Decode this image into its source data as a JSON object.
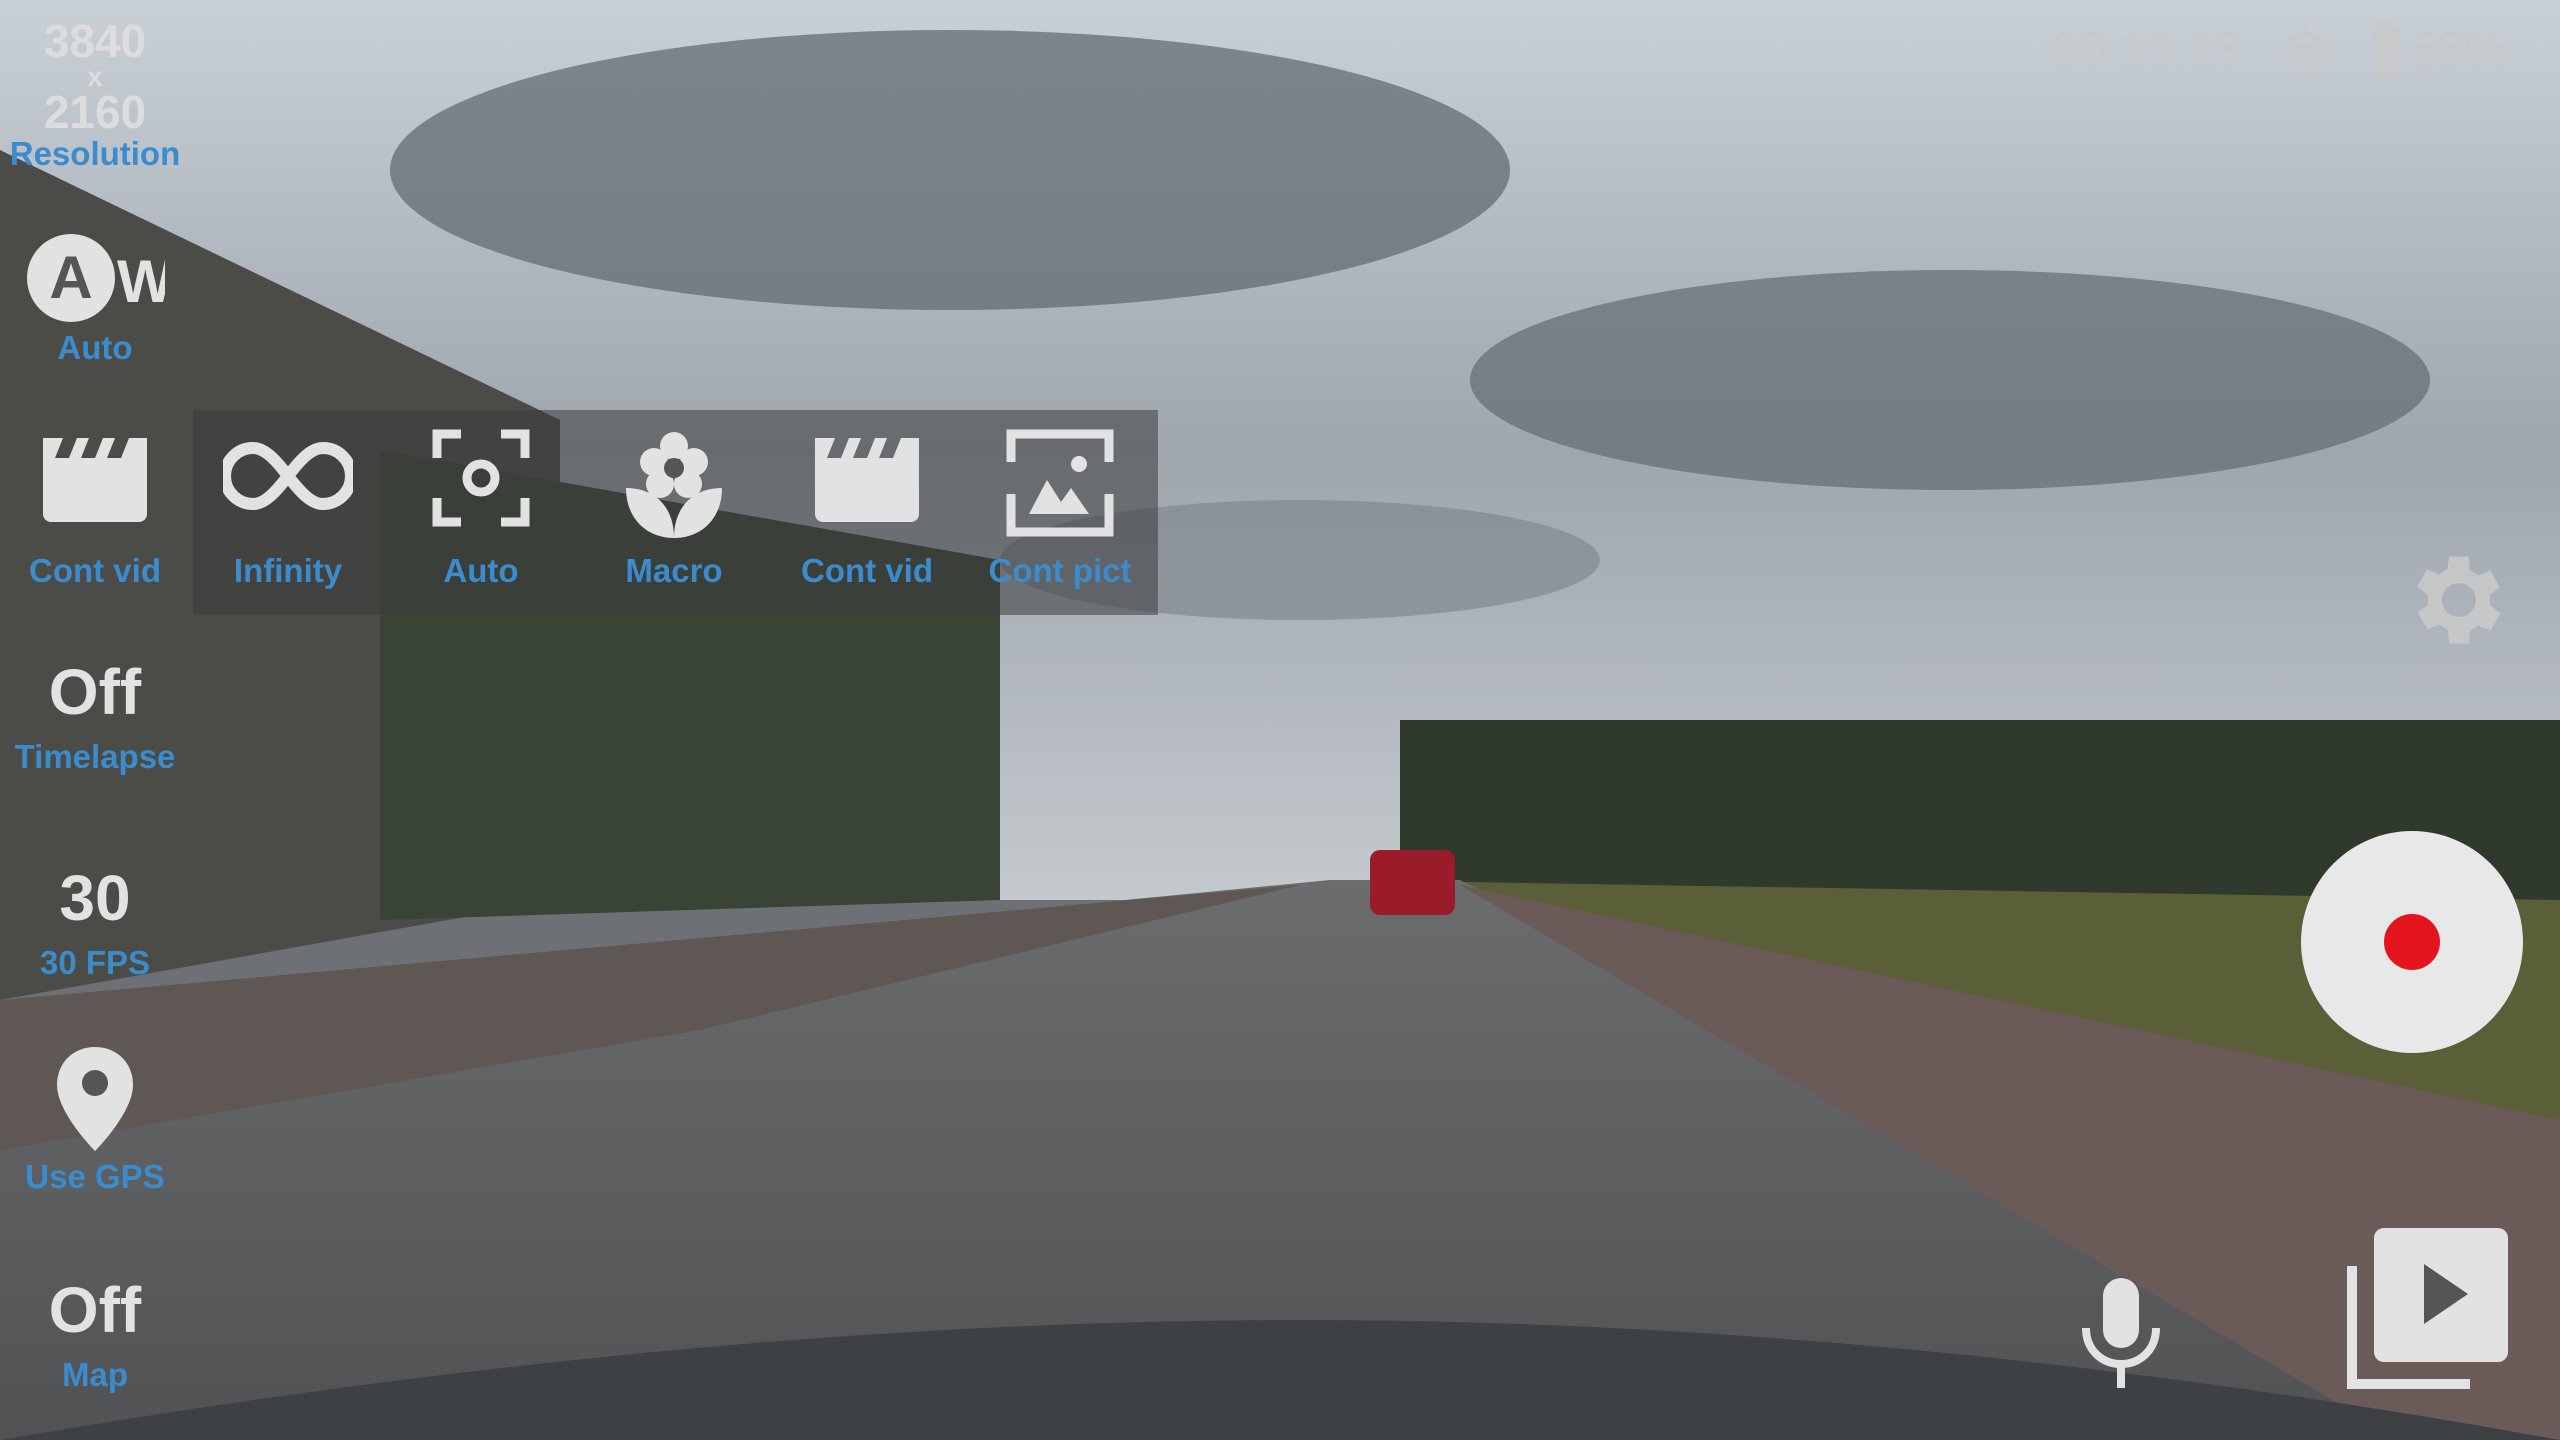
{
  "status": {
    "time": "00:13:23",
    "gps_icon": "gps-fixed-icon",
    "battery_icon": "battery-icon",
    "battery": "58%"
  },
  "left": {
    "resolution": {
      "width": "3840",
      "x": "x",
      "height": "2160",
      "label": "Resolution"
    },
    "white_balance": {
      "icon": "auto-white-balance-icon",
      "label": "Auto"
    },
    "mode": {
      "icon": "clapperboard-icon",
      "label": "Cont vid"
    },
    "timelapse": {
      "value": "Off",
      "label": "Timelapse"
    },
    "fps": {
      "value": "30",
      "label": "30 FPS"
    },
    "gps": {
      "icon": "location-pin-icon",
      "label": "Use GPS"
    },
    "map": {
      "value": "Off",
      "label": "Map"
    }
  },
  "focus_menu": [
    {
      "icon": "infinity-icon",
      "label": "Infinity"
    },
    {
      "icon": "center-focus-icon",
      "label": "Auto"
    },
    {
      "icon": "flower-macro-icon",
      "label": "Macro"
    },
    {
      "icon": "clapperboard-icon",
      "label": "Cont vid"
    },
    {
      "icon": "picture-focus-icon",
      "label": "Cont pict"
    }
  ],
  "right": {
    "settings_icon": "gear-icon",
    "record_icon": "record-icon",
    "mic_icon": "microphone-icon",
    "gallery_icon": "video-library-icon"
  },
  "colors": {
    "label": "#3b8ccc",
    "record": "#e3141c"
  }
}
